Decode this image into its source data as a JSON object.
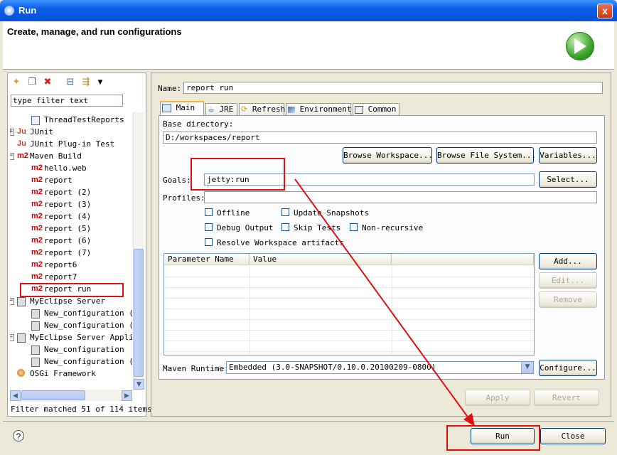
{
  "window": {
    "title": "Run",
    "close_glyph": "x"
  },
  "header": {
    "title": "Create, manage, and run configurations",
    "icon": "run-play-icon"
  },
  "left": {
    "filter_placeholder": "type filter text",
    "tree": [
      {
        "label": "ThreadTestReports",
        "icon": "file",
        "indent": 3
      },
      {
        "label": "JUnit",
        "icon": "ju",
        "indent": 1,
        "expander": "+"
      },
      {
        "label": "JUnit Plug-in Test",
        "icon": "ju",
        "indent": 1
      },
      {
        "label": "Maven Build",
        "icon": "m2",
        "indent": 1,
        "expander": "-"
      },
      {
        "label": "hello.web",
        "icon": "m2",
        "indent": 3
      },
      {
        "label": "report",
        "icon": "m2",
        "indent": 3
      },
      {
        "label": "report (2)",
        "icon": "m2",
        "indent": 3
      },
      {
        "label": "report (3)",
        "icon": "m2",
        "indent": 3
      },
      {
        "label": "report (4)",
        "icon": "m2",
        "indent": 3
      },
      {
        "label": "report (5)",
        "icon": "m2",
        "indent": 3
      },
      {
        "label": "report (6)",
        "icon": "m2",
        "indent": 3
      },
      {
        "label": "report (7)",
        "icon": "m2",
        "indent": 3
      },
      {
        "label": "report6",
        "icon": "m2",
        "indent": 3
      },
      {
        "label": "report7",
        "icon": "m2",
        "indent": 3
      },
      {
        "label": "report run",
        "icon": "m2",
        "indent": 3
      },
      {
        "label": "MyEclipse Server",
        "icon": "srv",
        "indent": 1,
        "expander": "-"
      },
      {
        "label": "New_configuration (",
        "icon": "srv",
        "indent": 3
      },
      {
        "label": "New_configuration (",
        "icon": "srv",
        "indent": 3
      },
      {
        "label": "MyEclipse Server Appli",
        "icon": "srv",
        "indent": 1,
        "expander": "-"
      },
      {
        "label": "New_configuration",
        "icon": "srv",
        "indent": 3
      },
      {
        "label": "New_configuration (",
        "icon": "srv",
        "indent": 3
      },
      {
        "label": "OSGi Framework",
        "icon": "osgi",
        "indent": 1
      }
    ],
    "status": "Filter matched 51 of 114 items"
  },
  "right": {
    "name_label": "Name:",
    "name_value": "report run",
    "tabs": [
      {
        "label": "Main",
        "icon": "main-tab-icon"
      },
      {
        "label": "JRE",
        "icon": "jre-icon"
      },
      {
        "label": "Refresh",
        "icon": "refresh-icon"
      },
      {
        "label": "Environment",
        "icon": "environment-icon"
      },
      {
        "label": "Common",
        "icon": "common-icon"
      }
    ],
    "base_dir_label": "Base directory:",
    "base_dir_value": "D:/workspaces/report",
    "browse_workspace": "Browse Workspace...",
    "browse_fs": "Browse File System...",
    "variables": "Variables...",
    "goals_label": "Goals:",
    "goals_value": "jetty:run",
    "select": "Select...",
    "profiles_label": "Profiles:",
    "profiles_value": "",
    "checks": {
      "offline": "Offline",
      "update_snapshots": "Update Snapshots",
      "debug_output": "Debug Output",
      "skip_tests": "Skip Tests",
      "non_recursive": "Non-recursive",
      "resolve_ws": "Resolve Workspace artifacts"
    },
    "table": {
      "col1": "Parameter Name",
      "col2": "Value"
    },
    "add": "Add...",
    "edit": "Edit...",
    "remove": "Remove",
    "runtime_label": "Maven Runtime:",
    "runtime_value": "Embedded (3.0-SNAPSHOT/0.10.0.20100209-0800)",
    "configure": "Configure...",
    "apply": "Apply",
    "revert": "Revert"
  },
  "footer": {
    "run": "Run",
    "close": "Close",
    "help": "?"
  }
}
